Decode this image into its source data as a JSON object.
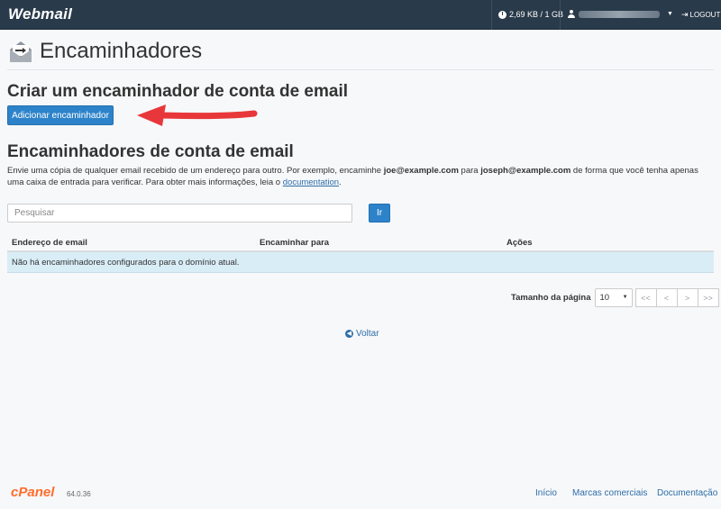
{
  "topbar": {
    "logo": "Webmail",
    "quota": "2,69 KB / 1 GB",
    "logout": "LOGOUT",
    "icons": {
      "quota": "clock-icon",
      "user": "user-icon",
      "logout": "logout-icon"
    }
  },
  "page": {
    "title": "Encaminhadores",
    "create_heading": "Criar um encaminhador de conta de email",
    "add_button": "Adicionar encaminhador",
    "list_heading": "Encaminhadores de conta de email",
    "description": {
      "part1": "Envie uma cópia de qualquer email recebido de um endereço para outro. Por exemplo, encaminhe ",
      "email1": "joe@example.com",
      "part2": " para ",
      "email2": "joseph@example.com",
      "part3": " de forma que você tenha apenas uma caixa de entrada para verificar. Para obter mais informações, leia o ",
      "link": "documentation",
      "part4": "."
    }
  },
  "search": {
    "placeholder": "Pesquisar",
    "button": "Ir"
  },
  "table": {
    "headers": [
      "Endereço de email",
      "Encaminhar para",
      "Ações"
    ],
    "empty_message": "Não há encaminhadores configurados para o domínio atual."
  },
  "pagination": {
    "label": "Tamanho da página",
    "page_size": "10",
    "buttons": [
      "<<",
      "<",
      ">",
      ">>"
    ]
  },
  "back_link": "Voltar",
  "footer": {
    "brand": "cPanel",
    "version": "64.0.36",
    "links": [
      "Início",
      "Marcas comerciais",
      "Documentação"
    ]
  },
  "colors": {
    "topbar": "#293a4a",
    "primary_button": "#2d83c9",
    "link": "#2d6ea8",
    "empty_row": "#d9edf7",
    "annotation_arrow": "#e8373a",
    "brand": "#ff6c2c"
  }
}
